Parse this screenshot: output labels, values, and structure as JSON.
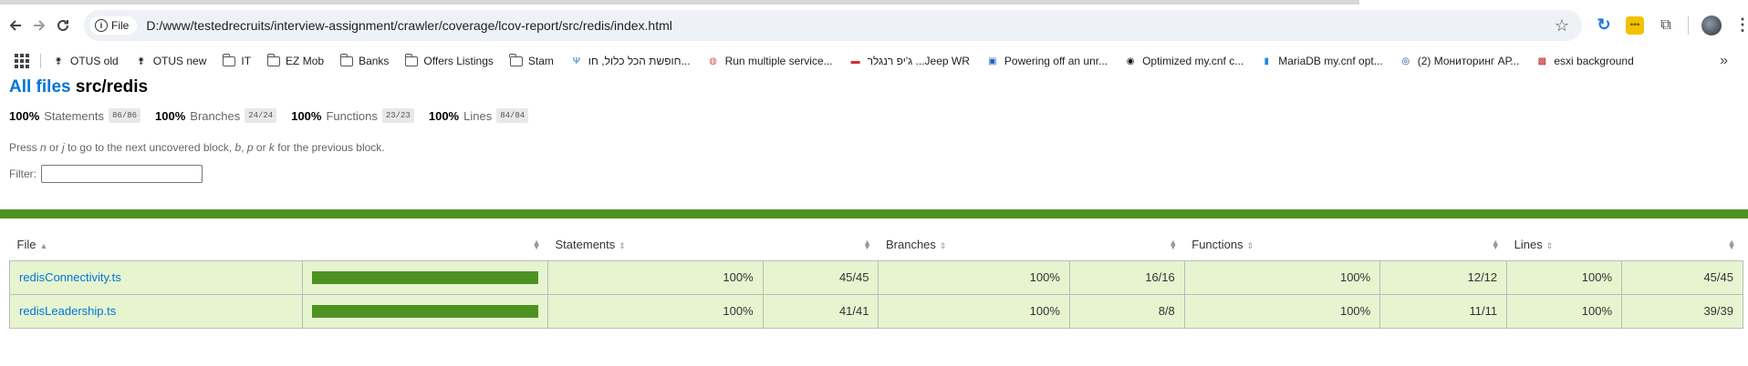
{
  "browser": {
    "site_chip": "File",
    "url": "D:/www/testedrecruits/interview-assignment/crawler/coverage/lcov-report/src/redis/index.html",
    "bookmarks": [
      {
        "label": "OTUS old",
        "icon": "otus-icon"
      },
      {
        "label": "OTUS new",
        "icon": "otus-icon"
      },
      {
        "label": "IT",
        "icon": "folder-icon"
      },
      {
        "label": "EZ Mob",
        "icon": "folder-icon"
      },
      {
        "label": "Banks",
        "icon": "folder-icon"
      },
      {
        "label": "Offers Listings",
        "icon": "folder-icon"
      },
      {
        "label": "Stam",
        "icon": "folder-icon"
      },
      {
        "label": "חופשת הכל כלול, חו...",
        "icon": "trident-icon"
      },
      {
        "label": "Run multiple service...",
        "icon": "globe-icon"
      },
      {
        "label": "ג'יפ רנגלר ...Jeep WR",
        "icon": "car-icon"
      },
      {
        "label": "Powering off an unr...",
        "icon": "vmware-icon"
      },
      {
        "label": "Optimized my.cnf c...",
        "icon": "github-icon"
      },
      {
        "label": "MariaDB my.cnf opt...",
        "icon": "db-icon"
      },
      {
        "label": "(2) Мониторинг АР...",
        "icon": "chat-icon"
      },
      {
        "label": "esxi background",
        "icon": "image-icon"
      }
    ],
    "more_label": "»"
  },
  "header": {
    "all_files_link": "All files",
    "path": "src/redis"
  },
  "summary": [
    {
      "pct": "100%",
      "label": "Statements",
      "fraction": "86/86"
    },
    {
      "pct": "100%",
      "label": "Branches",
      "fraction": "24/24"
    },
    {
      "pct": "100%",
      "label": "Functions",
      "fraction": "23/23"
    },
    {
      "pct": "100%",
      "label": "Lines",
      "fraction": "84/84"
    }
  ],
  "hint": {
    "p1": "Press ",
    "k1": "n",
    "p2": " or ",
    "k2": "j",
    "p3": " to go to the next uncovered block, ",
    "k3": "b",
    "p4": ", ",
    "k4": "p",
    "p5": " or ",
    "k5": "k",
    "p6": " for the previous block."
  },
  "filter_label": "Filter:",
  "table": {
    "headers": [
      "File",
      "Statements",
      "Branches",
      "Functions",
      "Lines"
    ],
    "rows": [
      {
        "file": "redisConnectivity.ts",
        "coverage_fraction": 1.0,
        "stmt_pct": "100%",
        "stmt_frac": "45/45",
        "br_pct": "100%",
        "br_frac": "16/16",
        "fn_pct": "100%",
        "fn_frac": "12/12",
        "ln_pct": "100%",
        "ln_frac": "45/45"
      },
      {
        "file": "redisLeadership.ts",
        "coverage_fraction": 1.0,
        "stmt_pct": "100%",
        "stmt_frac": "41/41",
        "br_pct": "100%",
        "br_frac": "8/8",
        "fn_pct": "100%",
        "fn_frac": "11/11",
        "ln_pct": "100%",
        "ln_frac": "39/39"
      }
    ]
  },
  "colors": {
    "high_coverage_bar": "#4d9221",
    "high_coverage_row": "#e6f5d0",
    "link": "#0074d9"
  }
}
